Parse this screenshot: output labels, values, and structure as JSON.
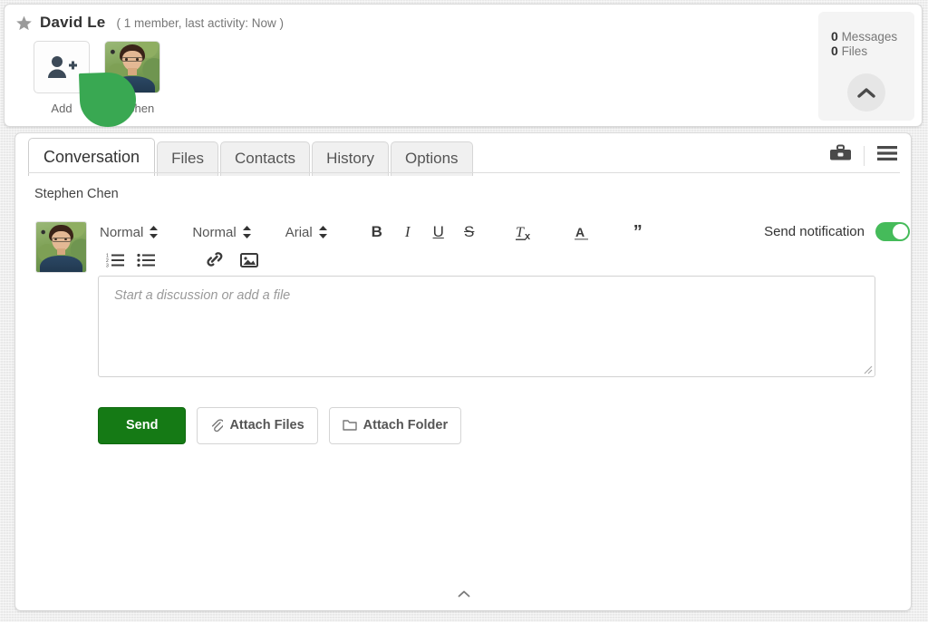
{
  "header": {
    "star_icon": "star-icon",
    "title": "David Le",
    "meta": "( 1 member, last activity: Now )",
    "members": [
      {
        "type": "add",
        "icon": "person-add-icon",
        "label": "Add"
      },
      {
        "type": "avatar",
        "icon": "user-avatar",
        "label": "Stephen"
      }
    ],
    "counts": {
      "messages_value": "0",
      "messages_label": "Messages",
      "files_value": "0",
      "files_label": "Files",
      "collapse_icon": "chevron-up-icon"
    }
  },
  "tabs": [
    {
      "label": "Conversation",
      "active": true
    },
    {
      "label": "Files",
      "active": false
    },
    {
      "label": "Contacts",
      "active": false
    },
    {
      "label": "History",
      "active": false
    },
    {
      "label": "Options",
      "active": false
    }
  ],
  "tab_actions": [
    {
      "name": "toolbox-icon",
      "label": "Toolbox"
    },
    {
      "name": "hamburger-menu-icon",
      "label": "Menu"
    }
  ],
  "conversation": {
    "sender_name": "Stephen Chen",
    "avatar_icon": "user-avatar"
  },
  "editor": {
    "dropdowns": [
      {
        "name": "paragraph-style-select",
        "value": "Normal"
      },
      {
        "name": "font-size-select",
        "value": "Normal"
      },
      {
        "name": "font-family-select",
        "value": "Arial"
      }
    ],
    "format_buttons": [
      {
        "name": "bold-button",
        "glyph": "B",
        "style": "b"
      },
      {
        "name": "italic-button",
        "glyph": "I",
        "style": "i"
      },
      {
        "name": "underline-button",
        "glyph": "U",
        "style": "u"
      },
      {
        "name": "strikethrough-button",
        "glyph": "S",
        "style": "s"
      },
      {
        "name": "clear-formatting-button",
        "glyph": "Tx",
        "style": "tx"
      },
      {
        "name": "text-color-button",
        "glyph": "A",
        "style": "color"
      },
      {
        "name": "blockquote-button",
        "glyph": "”",
        "style": "quote"
      }
    ],
    "row2_buttons": [
      {
        "name": "ordered-list-button"
      },
      {
        "name": "unordered-list-button"
      },
      {
        "name": "insert-link-button"
      },
      {
        "name": "insert-image-button"
      }
    ],
    "notification": {
      "label": "Send notification",
      "enabled": true,
      "accent_color": "#45bb5a"
    },
    "compose_placeholder": "Start a discussion or add a file"
  },
  "actions": {
    "send_label": "Send",
    "send_color": "#157a15",
    "attach_files_label": "Attach Files",
    "attach_files_icon": "paperclip-icon",
    "attach_folder_label": "Attach Folder",
    "attach_folder_icon": "folder-icon"
  },
  "footer": {
    "collapse_icon": "chevron-up-small-icon"
  }
}
